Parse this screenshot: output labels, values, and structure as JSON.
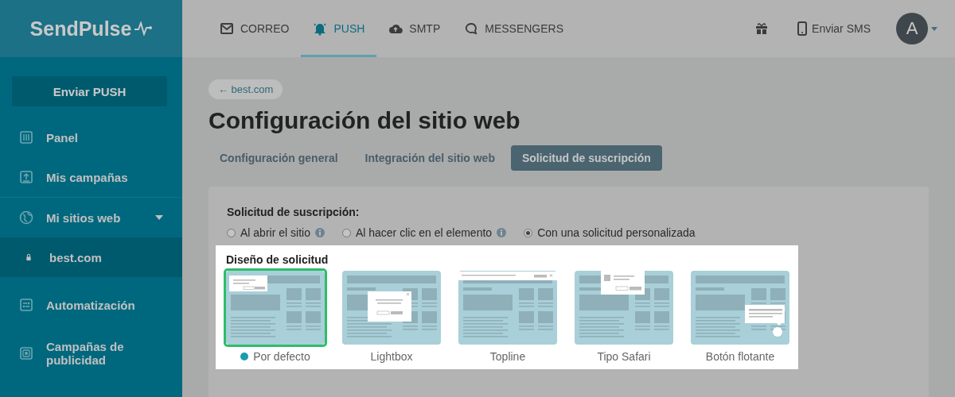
{
  "logo": {
    "text": "SendPulse"
  },
  "sidebar": {
    "action": "Enviar PUSH",
    "items": [
      {
        "label": "Panel",
        "kind": "panel",
        "selected": false
      },
      {
        "label": "Mis campañas",
        "kind": "upload",
        "selected": false
      },
      {
        "label": "Mi sitios web",
        "kind": "globe",
        "selected": false,
        "expanded": true,
        "children": [
          {
            "label": "best.com",
            "kind": "lock",
            "selected": true
          }
        ]
      },
      {
        "label": "Automatización",
        "kind": "flow",
        "selected": false
      },
      {
        "label": "Campañas de publicidad",
        "kind": "ads",
        "selected": false
      }
    ]
  },
  "topbar": {
    "tabs": [
      {
        "label": "CORREO",
        "kind": "mail",
        "selected": false
      },
      {
        "label": "PUSH",
        "kind": "bell",
        "selected": true
      },
      {
        "label": "SMTP",
        "kind": "cloud",
        "selected": false
      },
      {
        "label": "MESSENGERS",
        "kind": "chat",
        "selected": false
      }
    ],
    "sms": "Enviar SMS",
    "avatar": "A"
  },
  "back_link": "← best.com",
  "title": "Configuración del sitio web",
  "tabs": [
    {
      "label": "Configuración general",
      "selected": false
    },
    {
      "label": "Integración del sitio web",
      "selected": false
    },
    {
      "label": "Solicitud de suscripción",
      "selected": true
    }
  ],
  "subscription": {
    "label": "Solicitud de suscripción:",
    "options": [
      {
        "label": "Al abrir el sitio",
        "info": true,
        "selected": false
      },
      {
        "label": "Al hacer clic en el elemento",
        "info": true,
        "selected": false
      },
      {
        "label": "Con una solicitud personalizada",
        "info": false,
        "selected": true
      }
    ]
  },
  "design": {
    "label": "Diseño de solicitud",
    "options": [
      {
        "label": "Por defecto",
        "kind": "default",
        "selected": true
      },
      {
        "label": "Lightbox",
        "kind": "lightbox",
        "selected": false
      },
      {
        "label": "Topline",
        "kind": "topline",
        "selected": false
      },
      {
        "label": "Tipo Safari",
        "kind": "safari",
        "selected": false
      },
      {
        "label": "Botón flotante",
        "kind": "floating",
        "selected": false
      }
    ]
  }
}
